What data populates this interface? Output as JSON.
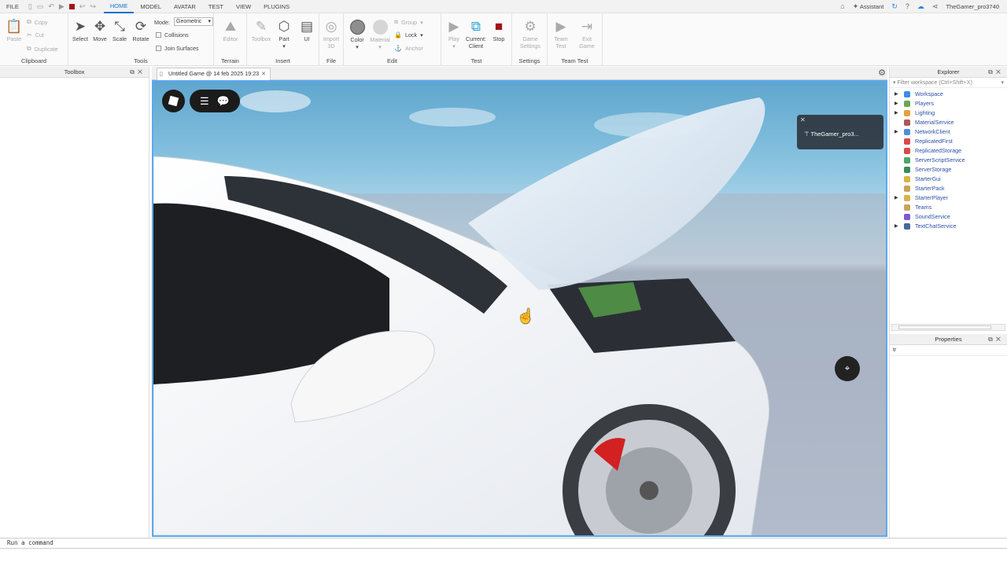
{
  "menubar": {
    "items": [
      "FILE",
      "HOME",
      "MODEL",
      "AVATAR",
      "TEST",
      "VIEW",
      "PLUGINS"
    ],
    "active": "HOME",
    "assistant": "Assistant",
    "username": "TheGamer_pro3740"
  },
  "ribbon": {
    "clipboard": {
      "label": "Clipboard",
      "paste": "Paste",
      "copy": "Copy",
      "cut": "Cut",
      "duplicate": "Duplicate"
    },
    "tools": {
      "label": "Tools",
      "select": "Select",
      "move": "Move",
      "scale": "Scale",
      "rotate": "Rotate",
      "mode_label": "Mode:",
      "mode_value": "Geometric",
      "collisions": "Collisions",
      "join_surfaces": "Join Surfaces"
    },
    "terrain": {
      "label": "Terrain",
      "editor": "Editor"
    },
    "insert": {
      "label": "Insert",
      "toolbox": "Toolbox",
      "part": "Part",
      "ui": "UI"
    },
    "file": {
      "label": "File",
      "import": "Import",
      "import_sub": "3D"
    },
    "edit": {
      "label": "Edit",
      "color": "Color",
      "material": "Material",
      "group": "Group",
      "lock": "Lock",
      "anchor": "Anchor"
    },
    "test": {
      "label": "Test",
      "play": "Play",
      "current": "Current:",
      "current_sub": "Client",
      "stop": "Stop"
    },
    "settings": {
      "label": "Settings",
      "game": "Game",
      "game_sub": "Settings"
    },
    "teamtest": {
      "label": "Team Test",
      "team": "Team",
      "team_sub": "Test",
      "exit": "Exit",
      "exit_sub": "Game"
    }
  },
  "toolbox": {
    "title": "Toolbox"
  },
  "document": {
    "tab_title": "Untitled Game @ 14 feb 2025 19:23"
  },
  "viewport": {
    "player_popup": "TheGamer_pro3..."
  },
  "explorer": {
    "title": "Explorer",
    "filter_placeholder": "Filter workspace (Ctrl+Shift+X)",
    "items": [
      {
        "label": "Workspace",
        "expandable": true,
        "color": "#3a8ee6"
      },
      {
        "label": "Players",
        "expandable": true,
        "color": "#6aa84f"
      },
      {
        "label": "Lighting",
        "expandable": true,
        "color": "#e6a23a"
      },
      {
        "label": "MaterialService",
        "expandable": false,
        "color": "#b05656"
      },
      {
        "label": "NetworkClient",
        "expandable": true,
        "color": "#4a90d9"
      },
      {
        "label": "ReplicatedFirst",
        "expandable": false,
        "color": "#d94a4a"
      },
      {
        "label": "ReplicatedStorage",
        "expandable": false,
        "color": "#d94a4a"
      },
      {
        "label": "ServerScriptService",
        "expandable": false,
        "color": "#4aa86a"
      },
      {
        "label": "ServerStorage",
        "expandable": false,
        "color": "#3a8a5a"
      },
      {
        "label": "StarterGui",
        "expandable": false,
        "color": "#d9b34a"
      },
      {
        "label": "StarterPack",
        "expandable": false,
        "color": "#c9a35a"
      },
      {
        "label": "StarterPlayer",
        "expandable": true,
        "color": "#d9b34a"
      },
      {
        "label": "Teams",
        "expandable": false,
        "color": "#c9a35a"
      },
      {
        "label": "SoundService",
        "expandable": false,
        "color": "#7a5ad9"
      },
      {
        "label": "TextChatService",
        "expandable": true,
        "color": "#4a6a9a"
      }
    ]
  },
  "properties": {
    "title": "Properties",
    "search_value": "tr"
  },
  "command": {
    "placeholder": "Run a command"
  }
}
